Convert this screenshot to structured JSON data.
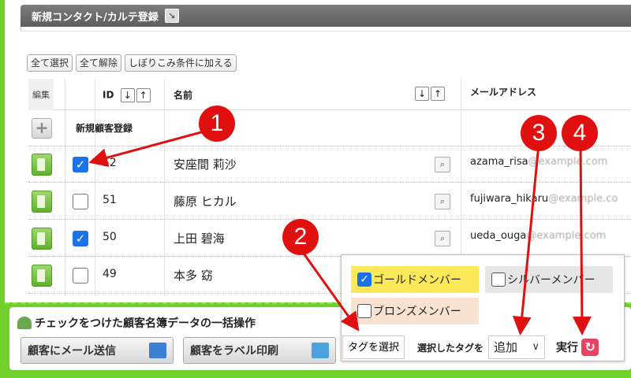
{
  "header": {
    "title": "新規コンタクト/カルテ登録"
  },
  "select_buttons": [
    "全て選択",
    "全て解除",
    "しぼりこみ条件に加える"
  ],
  "table": {
    "col_edit": "編集",
    "col_id": "ID",
    "col_name": "名前",
    "col_mail": "メールアドレス",
    "sort_down": "↓",
    "sort_up": "↑",
    "new_row_label": "新規顧客登録",
    "rows": [
      {
        "id": "52",
        "name": "安座間 莉沙",
        "mail_user": "azama_risa",
        "mail_domain": "@example.com",
        "checked": true
      },
      {
        "id": "51",
        "name": "藤原 ヒカル",
        "mail_user": "fujiwara_hikaru",
        "mail_domain": "@example.co",
        "checked": false
      },
      {
        "id": "50",
        "name": "上田 碧海",
        "mail_user": "ueda_ouga",
        "mail_domain": "@example.com",
        "checked": true
      },
      {
        "id": "49",
        "name": "本多 窈",
        "mail_user": "",
        "mail_domain": "",
        "checked": false
      }
    ]
  },
  "bulk": {
    "title": "チェックをつけた顧客名簿データの一括操作",
    "mail_button": "顧客にメール送信",
    "label_button": "顧客をラベル印刷"
  },
  "tags": {
    "items": [
      {
        "label": "ゴールドメンバー",
        "checked": true,
        "color": "#fbe95a"
      },
      {
        "label": "シルバーメンバー",
        "checked": false,
        "color": "#e6e6e6"
      },
      {
        "label": "ブロンズメンバー",
        "checked": false,
        "color": "#f8e3d2"
      }
    ],
    "select_button": "タグを選択",
    "selected_label": "選択したタグを",
    "action_value": "追加",
    "run_label": "実行"
  },
  "annotations": [
    "1",
    "2",
    "3",
    "4"
  ],
  "colors": {
    "frame": "#6fd02a",
    "badge": "#e01010",
    "checkbox": "#1a73e8"
  }
}
